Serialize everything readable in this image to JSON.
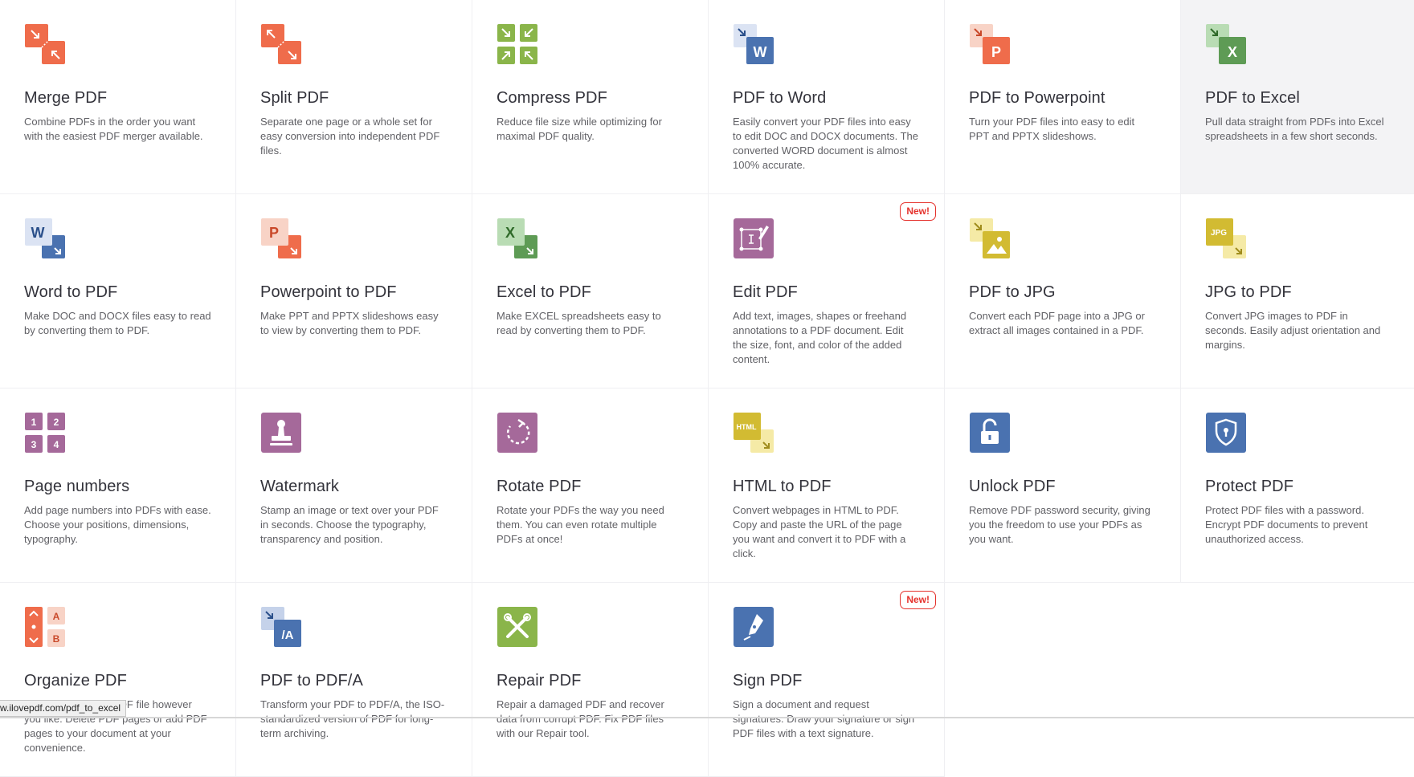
{
  "tools": [
    {
      "icon": "merge-pdf-icon",
      "title": "Merge PDF",
      "desc": "Combine PDFs in the order you want with the easiest PDF merger available.",
      "badge": ""
    },
    {
      "icon": "split-pdf-icon",
      "title": "Split PDF",
      "desc": "Separate one page or a whole set for easy conversion into independent PDF files.",
      "badge": ""
    },
    {
      "icon": "compress-pdf-icon",
      "title": "Compress PDF",
      "desc": "Reduce file size while optimizing for maximal PDF quality.",
      "badge": ""
    },
    {
      "icon": "pdf-to-word-icon",
      "title": "PDF to Word",
      "desc": "Easily convert your PDF files into easy to edit DOC and DOCX documents. The converted WORD document is almost 100% accurate.",
      "badge": ""
    },
    {
      "icon": "pdf-to-powerpoint-icon",
      "title": "PDF to Powerpoint",
      "desc": "Turn your PDF files into easy to edit PPT and PPTX slideshows.",
      "badge": ""
    },
    {
      "icon": "pdf-to-excel-icon",
      "title": "PDF to Excel",
      "desc": "Pull data straight from PDFs into Excel spreadsheets in a few short seconds.",
      "badge": ""
    },
    {
      "icon": "word-to-pdf-icon",
      "title": "Word to PDF",
      "desc": "Make DOC and DOCX files easy to read by converting them to PDF.",
      "badge": ""
    },
    {
      "icon": "powerpoint-to-pdf-icon",
      "title": "Powerpoint to PDF",
      "desc": "Make PPT and PPTX slideshows easy to view by converting them to PDF.",
      "badge": ""
    },
    {
      "icon": "excel-to-pdf-icon",
      "title": "Excel to PDF",
      "desc": "Make EXCEL spreadsheets easy to read by converting them to PDF.",
      "badge": ""
    },
    {
      "icon": "edit-pdf-icon",
      "title": "Edit PDF",
      "desc": "Add text, images, shapes or freehand annotations to a PDF document. Edit the size, font, and color of the added content.",
      "badge": "New!"
    },
    {
      "icon": "pdf-to-jpg-icon",
      "title": "PDF to JPG",
      "desc": "Convert each PDF page into a JPG or extract all images contained in a PDF.",
      "badge": ""
    },
    {
      "icon": "jpg-to-pdf-icon",
      "title": "JPG to PDF",
      "desc": "Convert JPG images to PDF in seconds. Easily adjust orientation and margins.",
      "badge": ""
    },
    {
      "icon": "page-numbers-icon",
      "title": "Page numbers",
      "desc": "Add page numbers into PDFs with ease. Choose your positions, dimensions, typography.",
      "badge": ""
    },
    {
      "icon": "watermark-icon",
      "title": "Watermark",
      "desc": "Stamp an image or text over your PDF in seconds. Choose the typography, transparency and position.",
      "badge": ""
    },
    {
      "icon": "rotate-pdf-icon",
      "title": "Rotate PDF",
      "desc": "Rotate your PDFs the way you need them. You can even rotate multiple PDFs at once!",
      "badge": ""
    },
    {
      "icon": "html-to-pdf-icon",
      "title": "HTML to PDF",
      "desc": "Convert webpages in HTML to PDF. Copy and paste the URL of the page you want and convert it to PDF with a click.",
      "badge": ""
    },
    {
      "icon": "unlock-pdf-icon",
      "title": "Unlock PDF",
      "desc": "Remove PDF password security, giving you the freedom to use your PDFs as you want.",
      "badge": ""
    },
    {
      "icon": "protect-pdf-icon",
      "title": "Protect PDF",
      "desc": "Protect PDF files with a password. Encrypt PDF documents to prevent unauthorized access.",
      "badge": ""
    },
    {
      "icon": "organize-pdf-icon",
      "title": "Organize PDF",
      "desc": "Sort pages of your PDF file however you like. Delete PDF pages or add PDF pages to your document at your convenience.",
      "badge": ""
    },
    {
      "icon": "pdf-to-pdfa-icon",
      "title": "PDF to PDF/A",
      "desc": "Transform your PDF to PDF/A, the ISO-standardized version of PDF for long-term archiving.",
      "badge": ""
    },
    {
      "icon": "repair-pdf-icon",
      "title": "Repair PDF",
      "desc": "Repair a damaged PDF and recover data from corrupt PDF. Fix PDF files with our Repair tool.",
      "badge": ""
    },
    {
      "icon": "sign-pdf-icon",
      "title": "Sign PDF",
      "desc": "Sign a document and request signatures. Draw your signature or sign PDF files with a text signature.",
      "badge": "New!"
    }
  ],
  "hovered_tool": "PDF to Excel",
  "status_url": "w.ilovepdf.com/pdf_to_excel",
  "icon_text": {
    "word": "W",
    "powerpoint": "P",
    "excel": "X",
    "jpg": "JPG",
    "html": "HTML",
    "pdfa": "/A",
    "numbers": [
      "1",
      "2",
      "3",
      "4"
    ],
    "organize": [
      "A",
      "B"
    ]
  },
  "colors": {
    "orange": "#ef6c4b",
    "green": "#8ab54a",
    "blue": "#4a72b0",
    "purple": "#a5699a",
    "yellow": "#d2bb32",
    "excel_green": "#5e9b55",
    "badge_red": "#e5322d"
  }
}
